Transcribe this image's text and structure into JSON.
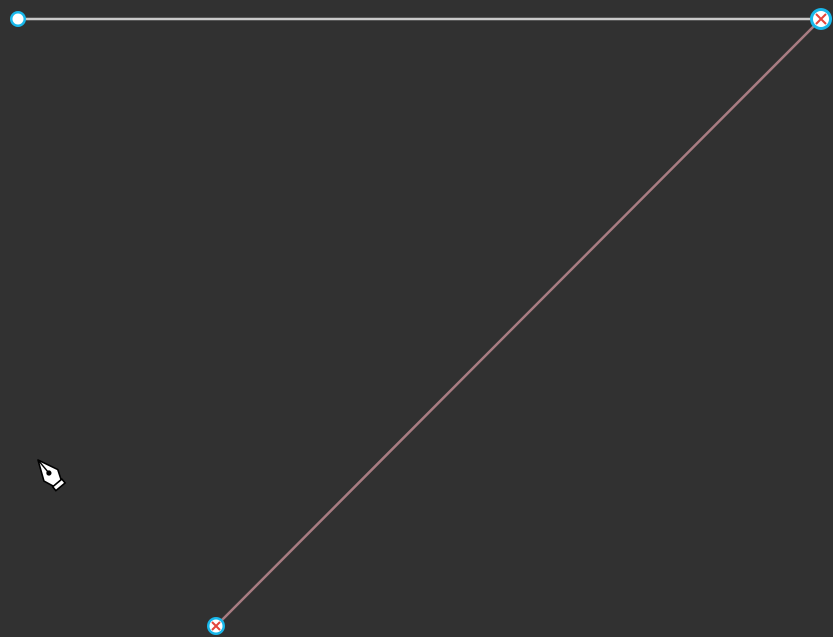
{
  "canvas": {
    "background": "#313131"
  },
  "paths": [
    {
      "name": "horizontal-path-segment",
      "color": "#c9c9c9",
      "anchors": [
        "start-anchor-point",
        "corner-anchor-point"
      ]
    },
    {
      "name": "diagonal-path-segment",
      "color": "#a87c82",
      "anchors": [
        "corner-anchor-point",
        "end-anchor-point"
      ]
    }
  ],
  "anchors": {
    "start": {
      "state": "open",
      "fill": "#ffffff",
      "ring": "#18b7ea"
    },
    "corner": {
      "state": "selected",
      "fill": "#ffffff",
      "ring": "#18b7ea",
      "marker": "#e2453c"
    },
    "end": {
      "state": "selected",
      "fill": "#ffffff",
      "ring": "#18b7ea",
      "marker": "#e2453c"
    }
  },
  "cursor": {
    "icon": "pen-tool-cursor-icon",
    "fill": "#ffffff",
    "outline": "#000000"
  }
}
